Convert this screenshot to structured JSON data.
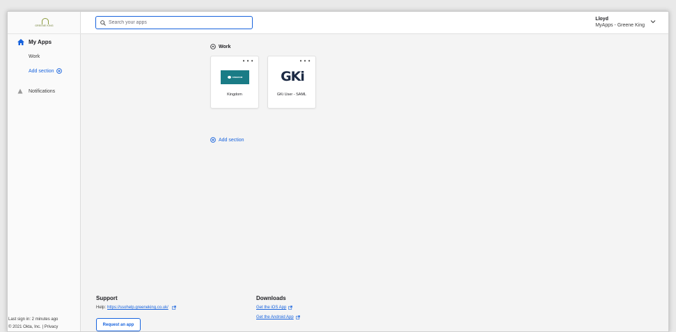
{
  "brand": {
    "logo_text": "GREENE KING",
    "accent": "#1662dd"
  },
  "sidebar": {
    "my_apps_label": "My Apps",
    "work_label": "Work",
    "add_section_label": "Add section",
    "notifications_label": "Notifications",
    "last_sign_in": "Last sign in: 2 minutes ago",
    "copyright": "© 2021 Okta, Inc.",
    "privacy": "Privacy"
  },
  "header": {
    "search_placeholder": "Search your apps",
    "user_name": "Lloyd",
    "user_org": "MyApps - Greene King"
  },
  "main": {
    "section_title": "Work",
    "apps": [
      {
        "label": "Kingdom",
        "logo_text": "KINGDOM",
        "icon": "kingdom-logo"
      },
      {
        "label": "GKi User - SAML",
        "logo_text": "GKi",
        "icon": "gki-logo"
      }
    ],
    "add_section_label": "Add section",
    "more_glyph": "• • •"
  },
  "footer": {
    "support_title": "Support",
    "help_prefix": "Help:",
    "help_link": "https://ssohelp.greeneking.co.uk/",
    "request_app_label": "Request an app",
    "downloads_title": "Downloads",
    "ios_link": "Get the iOS App",
    "android_link": "Get the Android App"
  }
}
